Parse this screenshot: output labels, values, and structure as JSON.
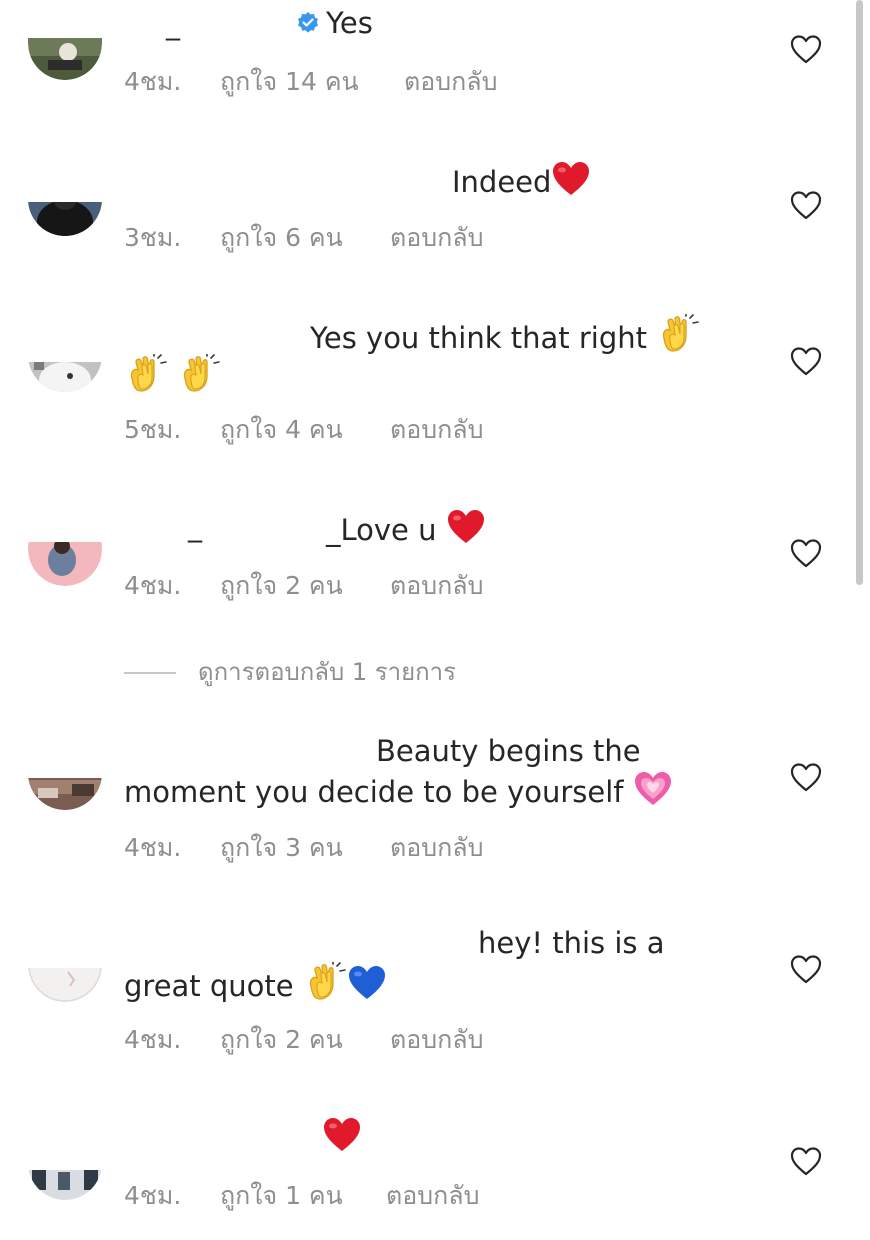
{
  "comments": [
    {
      "username_mark": "_",
      "text": "Yes",
      "verified": true,
      "time": "4ชม.",
      "likes": "ถูกใจ 14 คน",
      "reply": "ตอบกลับ"
    },
    {
      "username_mark": "",
      "text": "Indeed",
      "time": "3ชม.",
      "likes": "ถูกใจ 6 คน",
      "reply": "ตอบกลับ"
    },
    {
      "username_mark": "",
      "text": "Yes you think that right",
      "time": "5ชม.",
      "likes": "ถูกใจ 4 คน",
      "reply": "ตอบกลับ"
    },
    {
      "username_mark": "_",
      "username_mark2": "_",
      "text": "Love u",
      "time": "4ชม.",
      "likes": "ถูกใจ 2 คน",
      "reply": "ตอบกลับ"
    },
    {
      "text_line1": "Beauty begins the",
      "text_line2": "moment you decide to be yourself",
      "time": "4ชม.",
      "likes": "ถูกใจ 3 คน",
      "reply": "ตอบกลับ"
    },
    {
      "text_line1": "hey! this is a",
      "text_line2": "great quote",
      "time": "4ชม.",
      "likes": "ถูกใจ 2 คน",
      "reply": "ตอบกลับ"
    },
    {
      "text": "",
      "time": "4ชม.",
      "likes": "ถูกใจ 1 คน",
      "reply": "ตอบกลับ"
    }
  ],
  "view_replies": "ดูการตอบกลับ 1 รายการ",
  "icons": {
    "like": "heart-outline-icon",
    "verified": "verified-badge-icon"
  },
  "colors": {
    "text": "#262626",
    "meta": "#8e8e8e",
    "verified": "#3897f0",
    "red_heart": "#e0192b",
    "blue_heart": "#1f5fd6",
    "pink_heart": "#ef5da8",
    "clap": "#f7c531"
  }
}
